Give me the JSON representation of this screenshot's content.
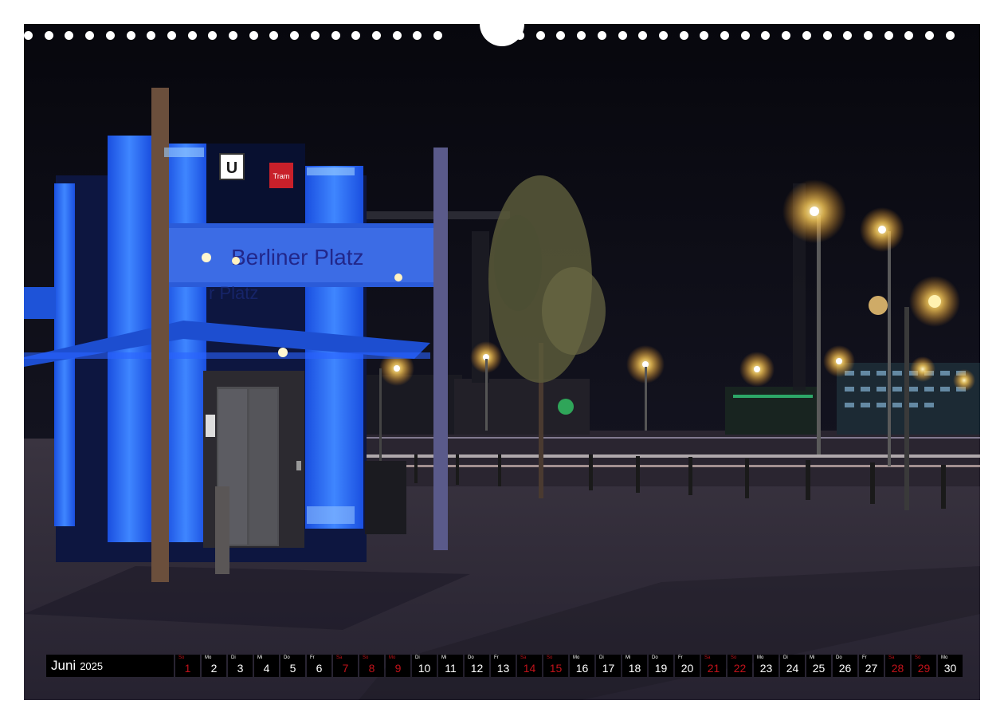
{
  "calendar": {
    "month": "Juni",
    "year": "2025",
    "days": [
      {
        "wd": "So",
        "num": "1",
        "weekend": true
      },
      {
        "wd": "Mo",
        "num": "2",
        "weekend": false
      },
      {
        "wd": "Di",
        "num": "3",
        "weekend": false
      },
      {
        "wd": "Mi",
        "num": "4",
        "weekend": false
      },
      {
        "wd": "Do",
        "num": "5",
        "weekend": false
      },
      {
        "wd": "Fr",
        "num": "6",
        "weekend": false
      },
      {
        "wd": "Sa",
        "num": "7",
        "weekend": true
      },
      {
        "wd": "So",
        "num": "8",
        "weekend": true
      },
      {
        "wd": "Mo",
        "num": "9",
        "weekend": true
      },
      {
        "wd": "Di",
        "num": "10",
        "weekend": false
      },
      {
        "wd": "Mi",
        "num": "11",
        "weekend": false
      },
      {
        "wd": "Do",
        "num": "12",
        "weekend": false
      },
      {
        "wd": "Fr",
        "num": "13",
        "weekend": false
      },
      {
        "wd": "Sa",
        "num": "14",
        "weekend": true
      },
      {
        "wd": "So",
        "num": "15",
        "weekend": true
      },
      {
        "wd": "Mo",
        "num": "16",
        "weekend": false
      },
      {
        "wd": "Di",
        "num": "17",
        "weekend": false
      },
      {
        "wd": "Mi",
        "num": "18",
        "weekend": false
      },
      {
        "wd": "Do",
        "num": "19",
        "weekend": false
      },
      {
        "wd": "Fr",
        "num": "20",
        "weekend": false
      },
      {
        "wd": "Sa",
        "num": "21",
        "weekend": true
      },
      {
        "wd": "So",
        "num": "22",
        "weekend": true
      },
      {
        "wd": "Mo",
        "num": "23",
        "weekend": false
      },
      {
        "wd": "Di",
        "num": "24",
        "weekend": false
      },
      {
        "wd": "Mi",
        "num": "25",
        "weekend": false
      },
      {
        "wd": "Do",
        "num": "26",
        "weekend": false
      },
      {
        "wd": "Fr",
        "num": "27",
        "weekend": false
      },
      {
        "wd": "Sa",
        "num": "28",
        "weekend": true
      },
      {
        "wd": "So",
        "num": "29",
        "weekend": true
      },
      {
        "wd": "Mo",
        "num": "30",
        "weekend": false
      }
    ]
  },
  "photo": {
    "station_sign": "Berliner Platz",
    "sign_u": "U",
    "sign_tram": "Tram",
    "reflection_text": "r Platz"
  },
  "colors": {
    "sky": "#0b0b14",
    "elevator_blue": "#1f66ff",
    "pavement": "#2e2a36",
    "weekend_red": "#c0121a",
    "calendar_bg": "#000000"
  }
}
